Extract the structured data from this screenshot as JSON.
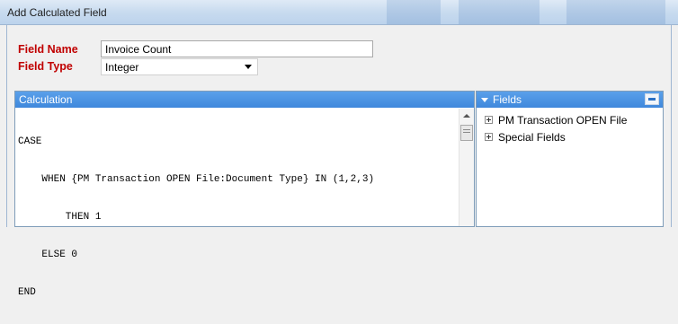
{
  "window": {
    "title": "Add Calculated Field"
  },
  "form": {
    "field_name_label": "Field Name",
    "field_name_value": "Invoice Count",
    "field_type_label": "Field Type",
    "field_type_value": "Integer"
  },
  "calculation": {
    "header": "Calculation",
    "lines": [
      "CASE",
      "    WHEN {PM Transaction OPEN File:Document Type} IN (1,2,3)",
      "        THEN 1",
      "    ELSE 0",
      "END"
    ]
  },
  "fields_panel": {
    "header": "Fields",
    "items": [
      "PM Transaction OPEN File",
      "Special Fields"
    ]
  },
  "colors": {
    "label_red": "#c00000",
    "header_blue": "#3f88dc"
  }
}
